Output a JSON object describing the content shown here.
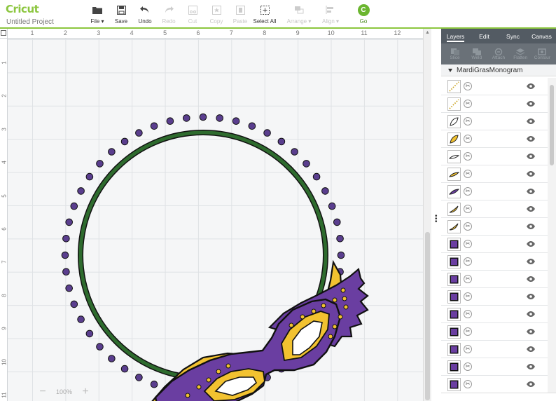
{
  "app": {
    "logo": "Cricut",
    "project_title": "Untitled Project"
  },
  "toolbar": {
    "file": "File ▾",
    "save": "Save",
    "undo": "Undo",
    "redo": "Redo",
    "cut": "Cut",
    "copy": "Copy",
    "paste": "Paste",
    "select_all": "Select All",
    "arrange": "Arrange ▾",
    "align": "Align ▾",
    "go": "Go",
    "go_glyph": "C"
  },
  "ruler": {
    "top": [
      "1",
      "2",
      "3",
      "4",
      "5",
      "6",
      "7",
      "8",
      "9",
      "10",
      "11",
      "12"
    ],
    "left": [
      "1",
      "2",
      "3",
      "4",
      "5",
      "6",
      "7",
      "8",
      "9",
      "10",
      "11"
    ]
  },
  "zoom": {
    "minus": "−",
    "value": "100%",
    "plus": "+"
  },
  "panel": {
    "tabs": [
      "Layers",
      "Edit",
      "Sync",
      "Canvas"
    ],
    "tools": [
      "Slice",
      "Weld",
      "Attach",
      "Flatten",
      "Contour"
    ],
    "group_name": "MardiGrasMonogram",
    "layers": [
      {
        "thumb": "dots-yellow"
      },
      {
        "thumb": "dots-yellow"
      },
      {
        "thumb": "leaf-outline"
      },
      {
        "thumb": "leaf-yellow"
      },
      {
        "thumb": "feather-outline"
      },
      {
        "thumb": "feather-yellow"
      },
      {
        "thumb": "feather-purple"
      },
      {
        "thumb": "swirl-yellow"
      },
      {
        "thumb": "swirl-yellow"
      },
      {
        "thumb": "square-purple"
      },
      {
        "thumb": "square-purple"
      },
      {
        "thumb": "square-purple"
      },
      {
        "thumb": "square-purple"
      },
      {
        "thumb": "square-purple"
      },
      {
        "thumb": "square-purple"
      },
      {
        "thumb": "square-purple"
      },
      {
        "thumb": "square-purple"
      },
      {
        "thumb": "square-purple"
      }
    ]
  },
  "colors": {
    "brand": "#8cc63f",
    "ring": "#2e6b2e",
    "dots": "#5a3e8e",
    "mask_purple": "#6a3ea1",
    "mask_yellow": "#f2c230"
  }
}
